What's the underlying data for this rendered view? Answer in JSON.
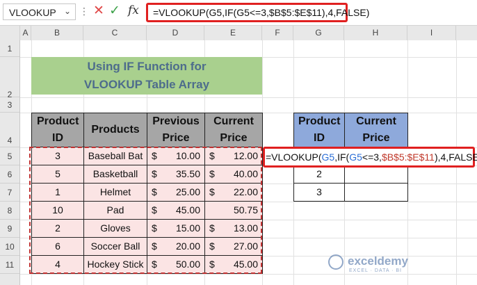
{
  "formula_bar": {
    "name_box": "VLOOKUP",
    "name_box_arrow": "⌄",
    "more_dots": "⋮",
    "cancel_icon": "✕",
    "enter_icon": "✓",
    "fx_label": "fx",
    "formula": "=VLOOKUP(G5,IF(G5<=3,$B$5:$E$11),4,FALSE)"
  },
  "columns": [
    "A",
    "B",
    "C",
    "D",
    "E",
    "F",
    "G",
    "H",
    "I"
  ],
  "rows": [
    "1",
    "2",
    "3",
    "4",
    "5",
    "6",
    "7",
    "8",
    "9",
    "10",
    "11"
  ],
  "title": {
    "line1": "Using IF Function for",
    "line2": "VLOOKUP Table Array"
  },
  "main_table": {
    "headers": {
      "product_id": "Product ID",
      "products": "Products",
      "previous_price": "Previous Price",
      "current_price": "Current Price"
    },
    "rows": [
      {
        "id": "3",
        "product": "Baseball Bat",
        "prev_symbol": "$",
        "prev": "10.00",
        "curr_symbol": "$",
        "curr": "12.00"
      },
      {
        "id": "5",
        "product": "Basketball",
        "prev_symbol": "$",
        "prev": "35.50",
        "curr_symbol": "$",
        "curr": "40.00"
      },
      {
        "id": "1",
        "product": "Helmet",
        "prev_symbol": "$",
        "prev": "25.00",
        "curr_symbol": "$",
        "curr": "22.00"
      },
      {
        "id": "10",
        "product": "Pad",
        "prev_symbol": "$",
        "prev": "45.00",
        "curr_symbol": "",
        "curr": "50.75"
      },
      {
        "id": "2",
        "product": "Gloves",
        "prev_symbol": "$",
        "prev": "15.00",
        "curr_symbol": "$",
        "curr": "13.00"
      },
      {
        "id": "6",
        "product": "Soccer Ball",
        "prev_symbol": "$",
        "prev": "20.00",
        "curr_symbol": "$",
        "curr": "27.00"
      },
      {
        "id": "4",
        "product": "Hockey Stick",
        "prev_symbol": "$",
        "prev": "50.00",
        "curr_symbol": "$",
        "curr": "45.00"
      }
    ]
  },
  "lookup_table": {
    "headers": {
      "product_id": "Product ID",
      "current_price": "Current Price"
    },
    "ids": [
      "",
      "2",
      "3"
    ]
  },
  "cell_formula": {
    "p1": "=VLOOKUP(",
    "p2": "G5",
    "p3": ",IF(",
    "p4": "G5",
    "p5": "<=3,",
    "p6": "$B$5:$E$11",
    "p7": "),4,FALSE)"
  },
  "watermark": {
    "name": "exceldemy",
    "tagline": "EXCEL · DATA · BI"
  },
  "colors": {
    "title_bg": "#a9d08e",
    "header_bg": "#a6a6a6",
    "data_bg": "#fbe4e4",
    "lookup_header_bg": "#8ea9db",
    "highlight_red": "#e02020"
  }
}
